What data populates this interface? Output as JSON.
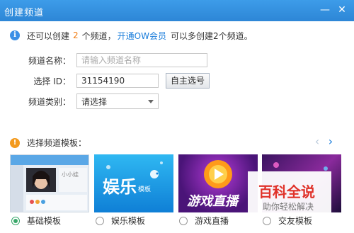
{
  "window": {
    "title": "创建频道",
    "minimize": "—",
    "close": "✕"
  },
  "info": {
    "prefix": "还可以创建",
    "count": "2",
    "middle": "个频道，",
    "link": "开通OW会员",
    "suffix": "可以多创建2个频道。"
  },
  "form": {
    "name_label": "频道名称：",
    "name_placeholder": "请输入频道名称",
    "id_label": "选择 ID：",
    "id_value": "31154190",
    "self_select_button": "自主选号",
    "category_label": "频道类别：",
    "category_value": "请选择"
  },
  "templates": {
    "heading": "选择频道模板：",
    "prev": "‹",
    "next": "›",
    "items": [
      {
        "label": "基础模板",
        "thumb_text": "小小娃",
        "checked": true
      },
      {
        "label": "娱乐模板",
        "thumb_text": "娱乐",
        "thumb_sub": "模板",
        "checked": false
      },
      {
        "label": "游戏直播",
        "thumb_text": "游戏直播",
        "checked": false
      },
      {
        "label": "交友模板",
        "checked": false
      }
    ]
  },
  "watermark": {
    "title": "百科全说",
    "subtitle": "助你轻松解决"
  },
  "colors": {
    "titlebar": "#2f8be0",
    "link": "#1a7ddb",
    "count": "#f07b10",
    "radio_checked": "#3aa86a",
    "watermark": "#e0322a"
  }
}
